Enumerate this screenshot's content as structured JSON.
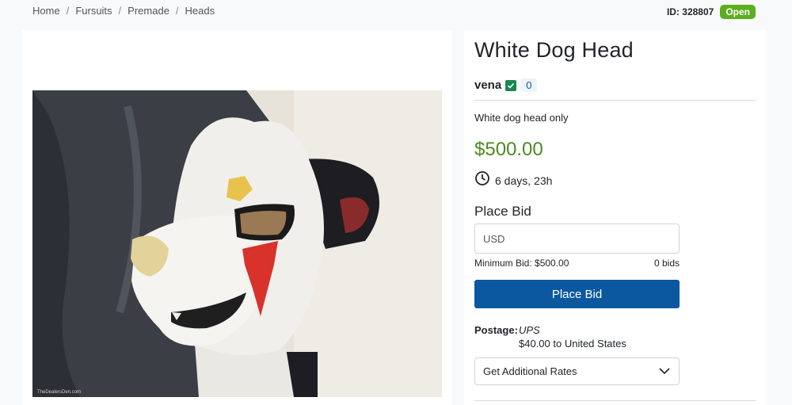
{
  "breadcrumb": [
    "Home",
    "Fursuits",
    "Premade",
    "Heads"
  ],
  "listing": {
    "id_label": "ID: 328807",
    "status": "Open",
    "title": "White Dog Head",
    "seller": "vena",
    "seller_rating": "0",
    "description": "White dog head only",
    "price": "$500.00",
    "time_left": "6 days, 23h",
    "photo_watermark": "TheDealersDen.com"
  },
  "bid": {
    "heading": "Place Bid",
    "placeholder": "USD",
    "minimum": "Minimum Bid: $500.00",
    "count": "0 bids",
    "button_label": "Place Bid"
  },
  "postage": {
    "label": "Postage:",
    "carrier": "UPS",
    "cost": "$40.00 to United States",
    "rates_label": "Get Additional Rates"
  },
  "colors": {
    "status_badge": "#5cae1f",
    "price": "#4c8a1f",
    "primary_button": "#0c58a0",
    "verified": "#198754"
  },
  "icons": {
    "verified": "check-square-icon",
    "time": "clock-icon",
    "dropdown": "chevron-down-icon"
  }
}
